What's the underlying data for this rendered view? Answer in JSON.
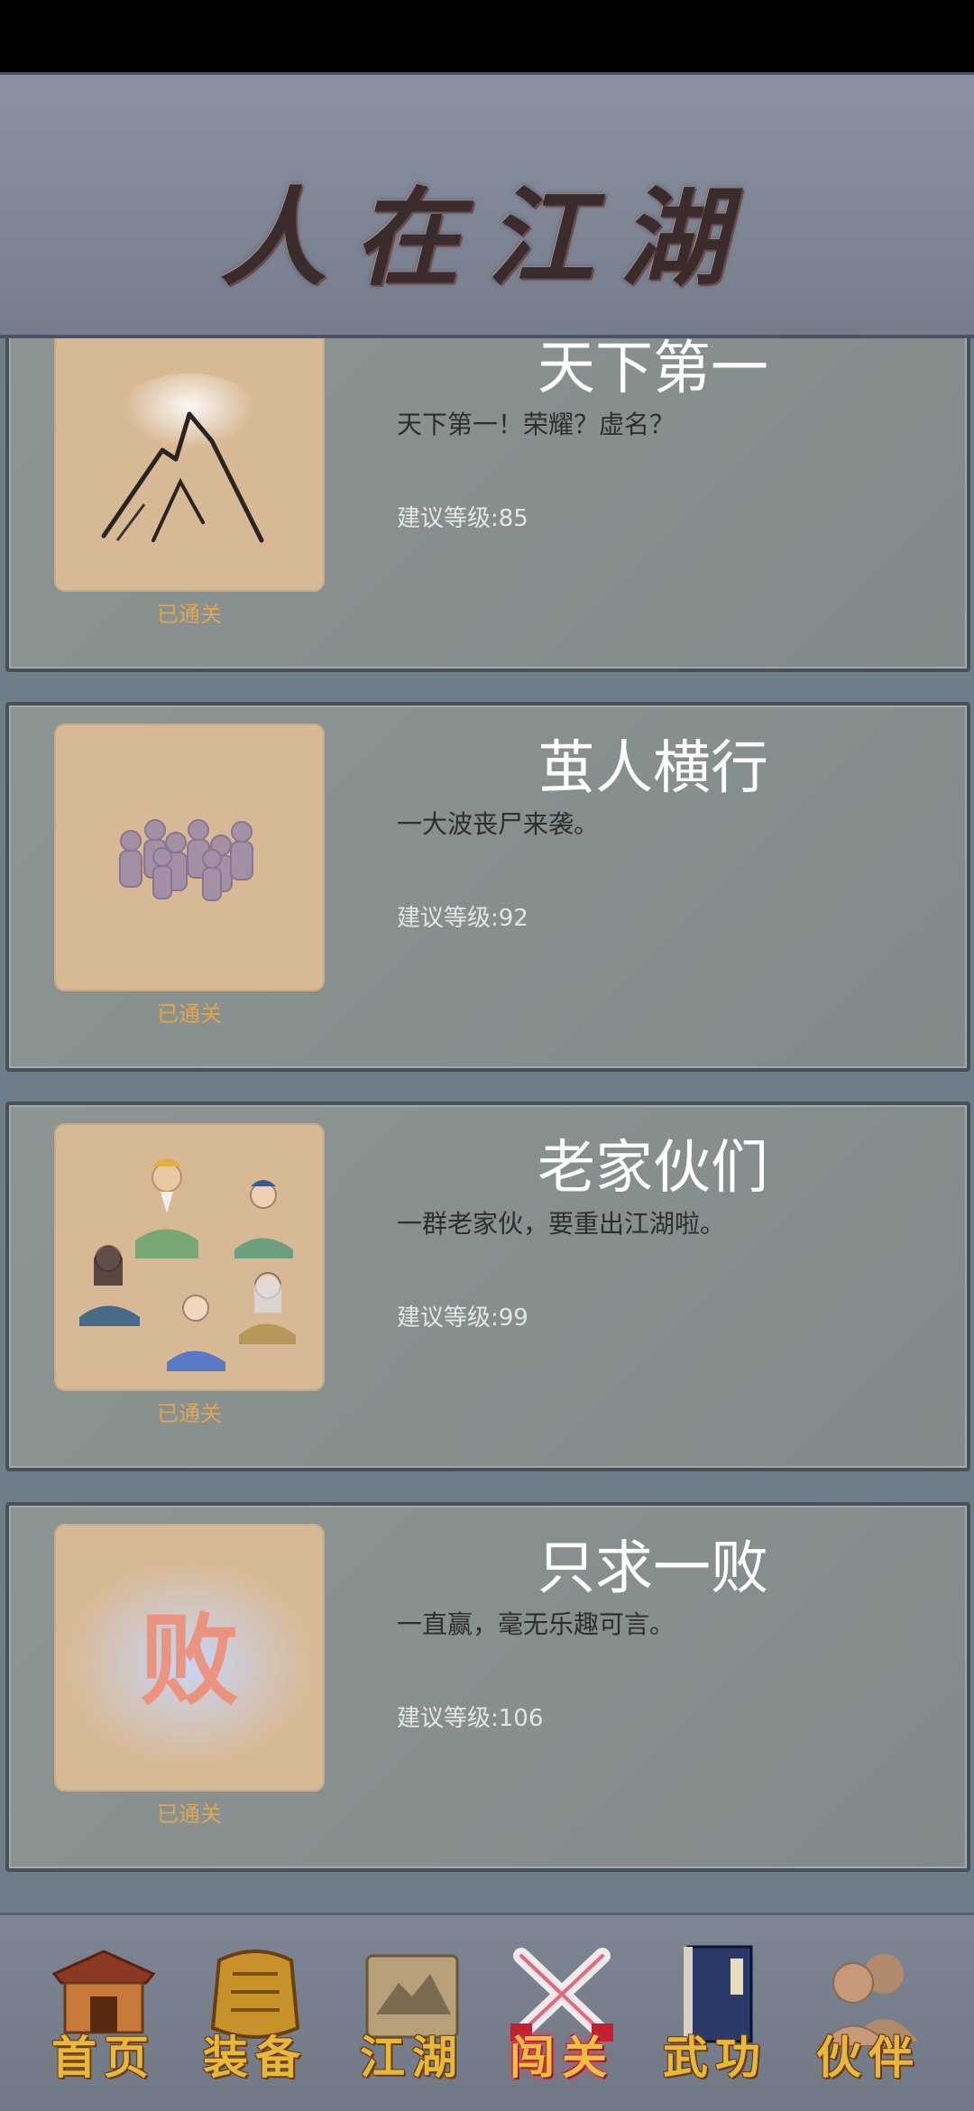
{
  "header": {
    "title": "人在江湖"
  },
  "levels": [
    {
      "title": "天下第一",
      "desc": "天下第一！荣耀？虚名？",
      "level": "建议等级:85",
      "status": "已通关",
      "image": "mountain-icon"
    },
    {
      "title": "茧人横行",
      "desc": "一大波丧尸来袭。",
      "level": "建议等级:92",
      "status": "已通关",
      "image": "zombies-icon"
    },
    {
      "title": "老家伙们",
      "desc": "一群老家伙，要重出江湖啦。",
      "level": "建议等级:99",
      "status": "已通关",
      "image": "elders-icon"
    },
    {
      "title": "只求一败",
      "desc": "一直赢，毫无乐趣可言。",
      "level": "建议等级:106",
      "status": "已通关",
      "image": "defeat-char-icon",
      "image_text": "败"
    }
  ],
  "nav": [
    {
      "label": "首页",
      "icon": "house-icon"
    },
    {
      "label": "装备",
      "icon": "armor-icon"
    },
    {
      "label": "江湖",
      "icon": "scroll-map-icon"
    },
    {
      "label": "闯关",
      "icon": "crossed-swords-icon",
      "active": true
    },
    {
      "label": "武功",
      "icon": "book-icon"
    },
    {
      "label": "伙伴",
      "icon": "partners-icon"
    }
  ],
  "colors": {
    "status": "#e5a64a",
    "nav_label": "#e8b83a",
    "card_bg": "#878f8f"
  }
}
